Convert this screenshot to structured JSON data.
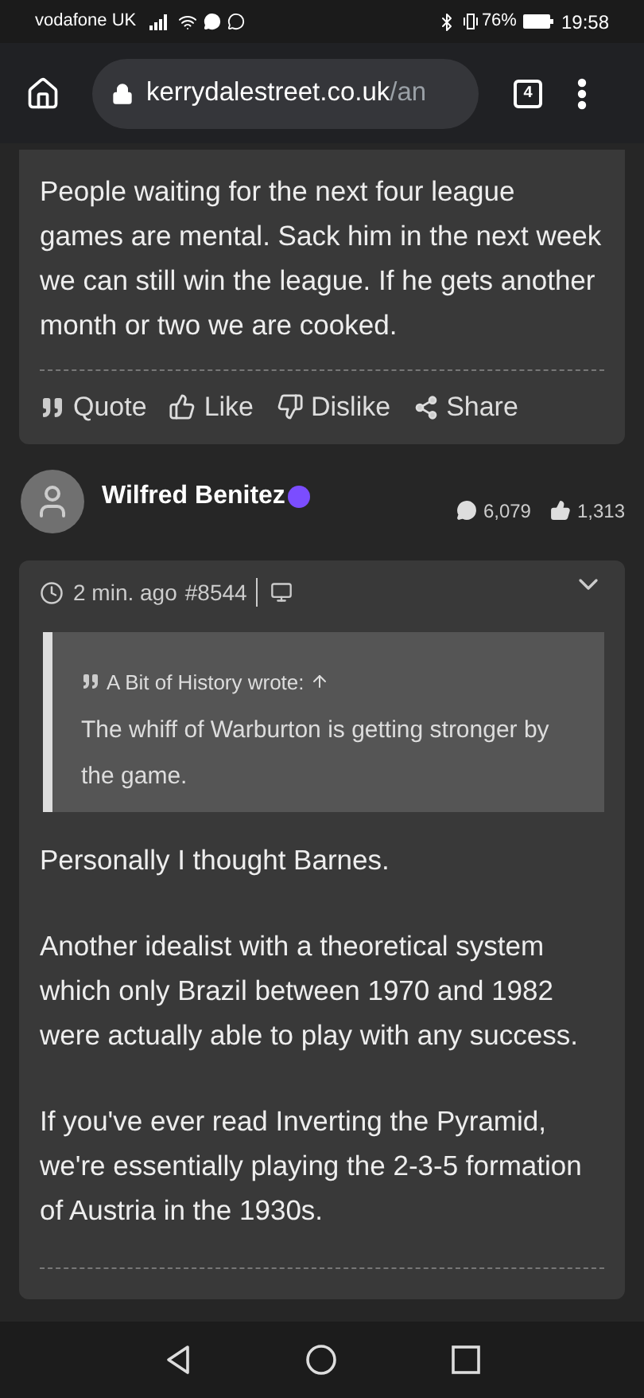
{
  "status_bar": {
    "carrier": "vodafone UK",
    "battery": "76%",
    "time": "19:58"
  },
  "browser": {
    "url_host": "kerrydalestreet.co.uk",
    "url_path": "/an",
    "tab_count": "4"
  },
  "previous_post": {
    "text": "People waiting for the next four league games are mental. Sack him in the next week we can still win the league. If he gets another month or two we are cooked.",
    "actions": [
      {
        "kind": "quote",
        "label": "Quote"
      },
      {
        "kind": "like",
        "label": "Like"
      },
      {
        "kind": "dislike",
        "label": "Dislike"
      },
      {
        "kind": "share",
        "label": "Share"
      }
    ]
  },
  "author": {
    "name": "Wilfred Benitez",
    "posts": "6,079",
    "likes": "1,313"
  },
  "post": {
    "time": "2 min. ago",
    "number": "#8544",
    "quote": {
      "author": "A Bit of History wrote:",
      "text": "The whiff of Warburton is getting stronger by the game."
    },
    "paragraphs": [
      "Personally I thought Barnes.",
      "Another idealist with a theoretical system which only Brazil between 1970 and 1982 were actually able to play with any success.",
      "If you've ever read Inverting the Pyramid, we're essentially playing the 2-3-5 formation of Austria in the 1930s."
    ]
  }
}
